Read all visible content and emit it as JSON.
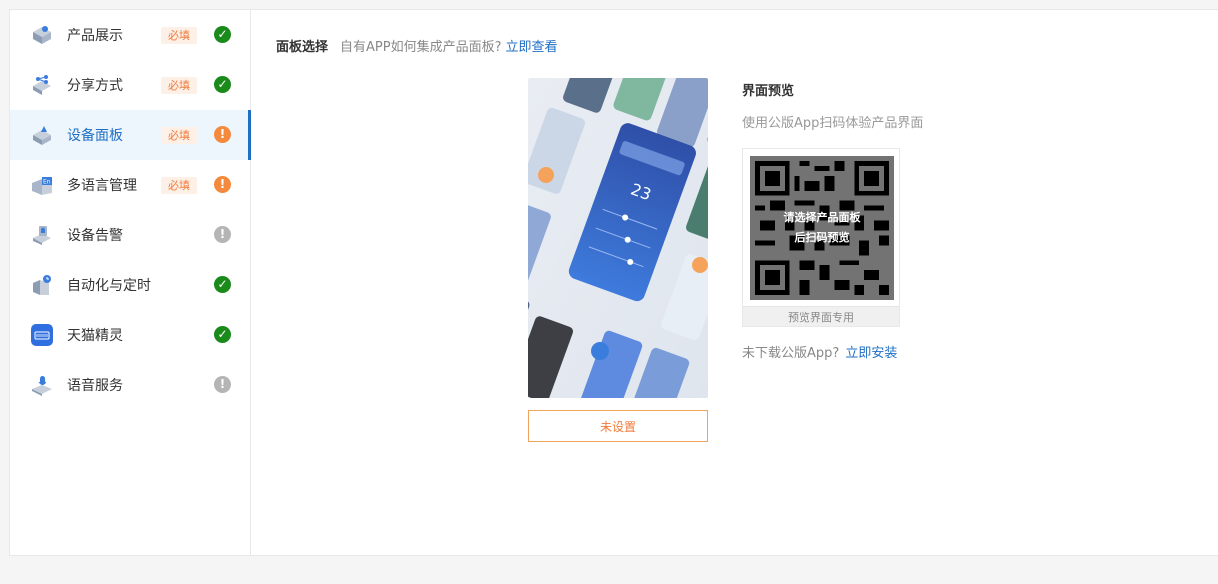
{
  "sidebar": {
    "items": [
      {
        "label": "产品展示",
        "required": "必填",
        "status": "ok",
        "icon": "product-display-icon"
      },
      {
        "label": "分享方式",
        "required": "必填",
        "status": "ok",
        "icon": "share-icon"
      },
      {
        "label": "设备面板",
        "required": "必填",
        "status": "warn",
        "icon": "device-panel-icon",
        "active": true
      },
      {
        "label": "多语言管理",
        "required": "必填",
        "status": "warn",
        "icon": "language-icon"
      },
      {
        "label": "设备告警",
        "status": "gray",
        "icon": "alarm-icon"
      },
      {
        "label": "自动化与定时",
        "status": "ok",
        "icon": "automation-icon"
      },
      {
        "label": "天猫精灵",
        "status": "ok",
        "icon": "tmall-genie-icon"
      },
      {
        "label": "语音服务",
        "status": "gray",
        "icon": "voice-service-icon"
      }
    ]
  },
  "main": {
    "header": {
      "title": "面板选择",
      "question": "自有APP如何集成产品面板?",
      "link": "立即查看"
    },
    "phone_preview": {
      "temperature": "23"
    },
    "unset_button": "未设置",
    "preview": {
      "title": "界面预览",
      "subtitle": "使用公版App扫码体验产品界面",
      "qr_overlay_line1": "请选择产品面板",
      "qr_overlay_line2": "后扫码预览",
      "qr_footer": "预览界面专用",
      "install_text": "未下载公版App?",
      "install_link": "立即安装"
    }
  },
  "colors": {
    "accent": "#1f6fc5",
    "ok": "#1a8a1a",
    "warn": "#f48a3d",
    "gray": "#b5b5b5",
    "required": "#f07a3a"
  }
}
